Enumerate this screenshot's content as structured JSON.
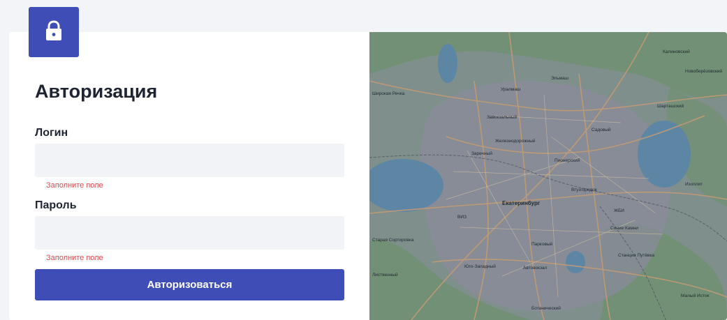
{
  "auth": {
    "title": "Авторизация",
    "login_label": "Логин",
    "login_value": "",
    "login_error": "Заполните поле",
    "password_label": "Пароль",
    "password_value": "",
    "password_error": "Заполните поле",
    "submit_label": "Авторизоваться"
  },
  "map": {
    "city_label": "Екатеринбург",
    "labels": [
      "Уралмаш",
      "Эльмаш",
      "Заречный",
      "Пионерский",
      "Втузгородок",
      "ВИЗ",
      "Парковый",
      "Юго-Западный",
      "Автовокзал",
      "Шарташский",
      "Ботанический",
      "Лиственный",
      "Калиновский",
      "Новоберёзовский",
      "Станция Путёвка",
      "Синие Камни",
      "Завокзальный",
      "Садовый",
      "Изоплит",
      "Железнодорожный",
      "ЖБИ",
      "Старая Сортировка",
      "Широкая Речка",
      "Малый Исток"
    ]
  },
  "colors": {
    "accent": "#3f4db6",
    "error": "#e0484e",
    "input_bg": "#f2f3f6",
    "text": "#1f2432"
  }
}
